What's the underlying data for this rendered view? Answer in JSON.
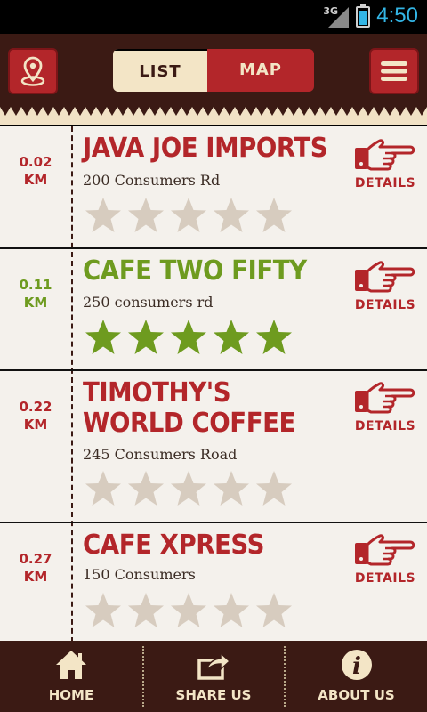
{
  "status": {
    "network": "3G",
    "time": "4:50"
  },
  "header": {
    "tabs": [
      {
        "label": "LIST",
        "active": true
      },
      {
        "label": "MAP",
        "active": false
      }
    ]
  },
  "colors": {
    "brand_red": "#b3262a",
    "brown": "#3b1a14",
    "green": "#6e9b1f",
    "cream": "#f3e5c6",
    "star_grey": "#d7ccbf"
  },
  "cafes": [
    {
      "distance": "0.02",
      "unit": "KM",
      "name": "JAVA JOE IMPORTS",
      "address": "200 Consumers Rd",
      "rating": 0,
      "highlight": false,
      "details": "DETAILS"
    },
    {
      "distance": "0.11",
      "unit": "KM",
      "name": "CAFE TWO FIFTY",
      "address": "250 consumers rd",
      "rating": 5,
      "highlight": true,
      "details": "DETAILS"
    },
    {
      "distance": "0.22",
      "unit": "KM",
      "name": "TIMOTHY'S WORLD COFFEE",
      "address": "245 Consumers Road",
      "rating": 0,
      "highlight": false,
      "details": "DETAILS"
    },
    {
      "distance": "0.27",
      "unit": "KM",
      "name": "CAFE XPRESS",
      "address": "150 Consumers",
      "rating": 0,
      "highlight": false,
      "details": "DETAILS"
    }
  ],
  "footer": {
    "home": "HOME",
    "share": "SHARE US",
    "about": "ABOUT US"
  },
  "icons": {
    "location": "location-pin-icon",
    "menu": "hamburger-menu-icon",
    "details": "pointing-hand-icon",
    "home": "house-icon",
    "share": "share-arrow-icon",
    "about": "info-icon",
    "star": "star-icon"
  }
}
